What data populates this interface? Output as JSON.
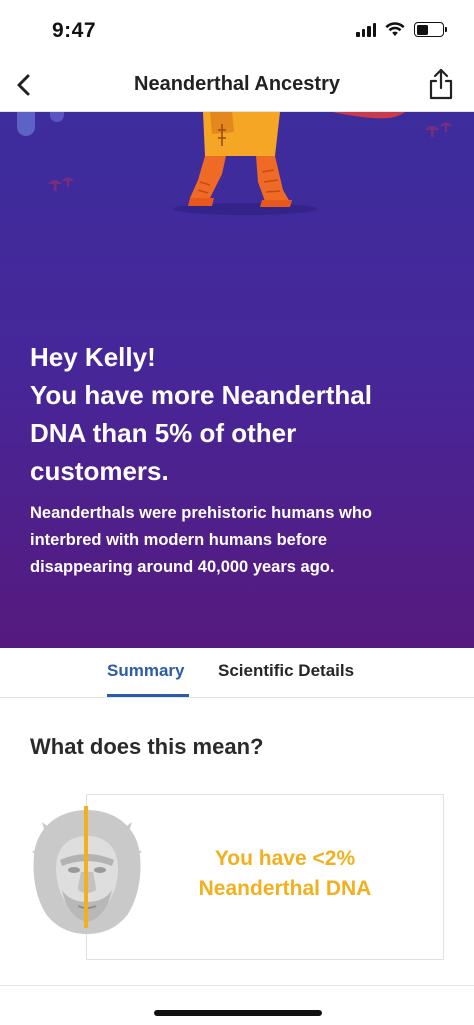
{
  "status_bar": {
    "time": "9:47",
    "icons": [
      "signal-icon",
      "wifi-icon",
      "battery-icon"
    ]
  },
  "nav": {
    "title": "Neanderthal Ancestry",
    "back_icon": "chevron-left-icon",
    "share_icon": "share-icon"
  },
  "hero": {
    "heading_lines": [
      "Hey Kelly!",
      "You have more Neanderthal",
      "DNA than 5% of other",
      "customers."
    ],
    "description": "Neanderthals were prehistoric humans who interbred with modern humans before disappearing around 40,000 years ago.",
    "colors": {
      "gradient_top": "#3d2d9c",
      "gradient_bottom": "#561a7e"
    }
  },
  "tabs": [
    {
      "label": "Summary",
      "active": true
    },
    {
      "label": "Scientific Details",
      "active": false
    }
  ],
  "section": {
    "title": "What does this mean?",
    "result_text": "You have <2% Neanderthal DNA",
    "accent_color": "#f2b01e"
  }
}
